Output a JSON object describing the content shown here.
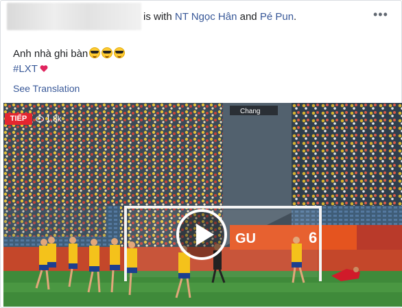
{
  "post": {
    "header": {
      "with_text": "is with",
      "tagged_1": "NT Ngọc Hân",
      "and_text": "and",
      "tagged_2": "Pé Pun",
      "period": "."
    },
    "more_icon": "more-horizontal-icon",
    "text": "Anh nhà ghi bàn",
    "emojis": [
      "sunglasses-face",
      "sunglasses-face",
      "sunglasses-face"
    ],
    "hashtag": "#LXT",
    "heart_color": "#e0245e",
    "see_translation": "See Translation"
  },
  "video": {
    "live_label": "TIẾP",
    "view_count": "1,8k",
    "stadium_sign": "Chang",
    "ad_board": "GU",
    "ad_board_2": "6",
    "play_icon": "play-icon",
    "colors": {
      "pitch": "#3f8a3a",
      "home_kit": "#f4c21b",
      "away_kit": "#222222",
      "goalkeeper": "#d11a2a",
      "live_badge": "#e4262f"
    }
  }
}
